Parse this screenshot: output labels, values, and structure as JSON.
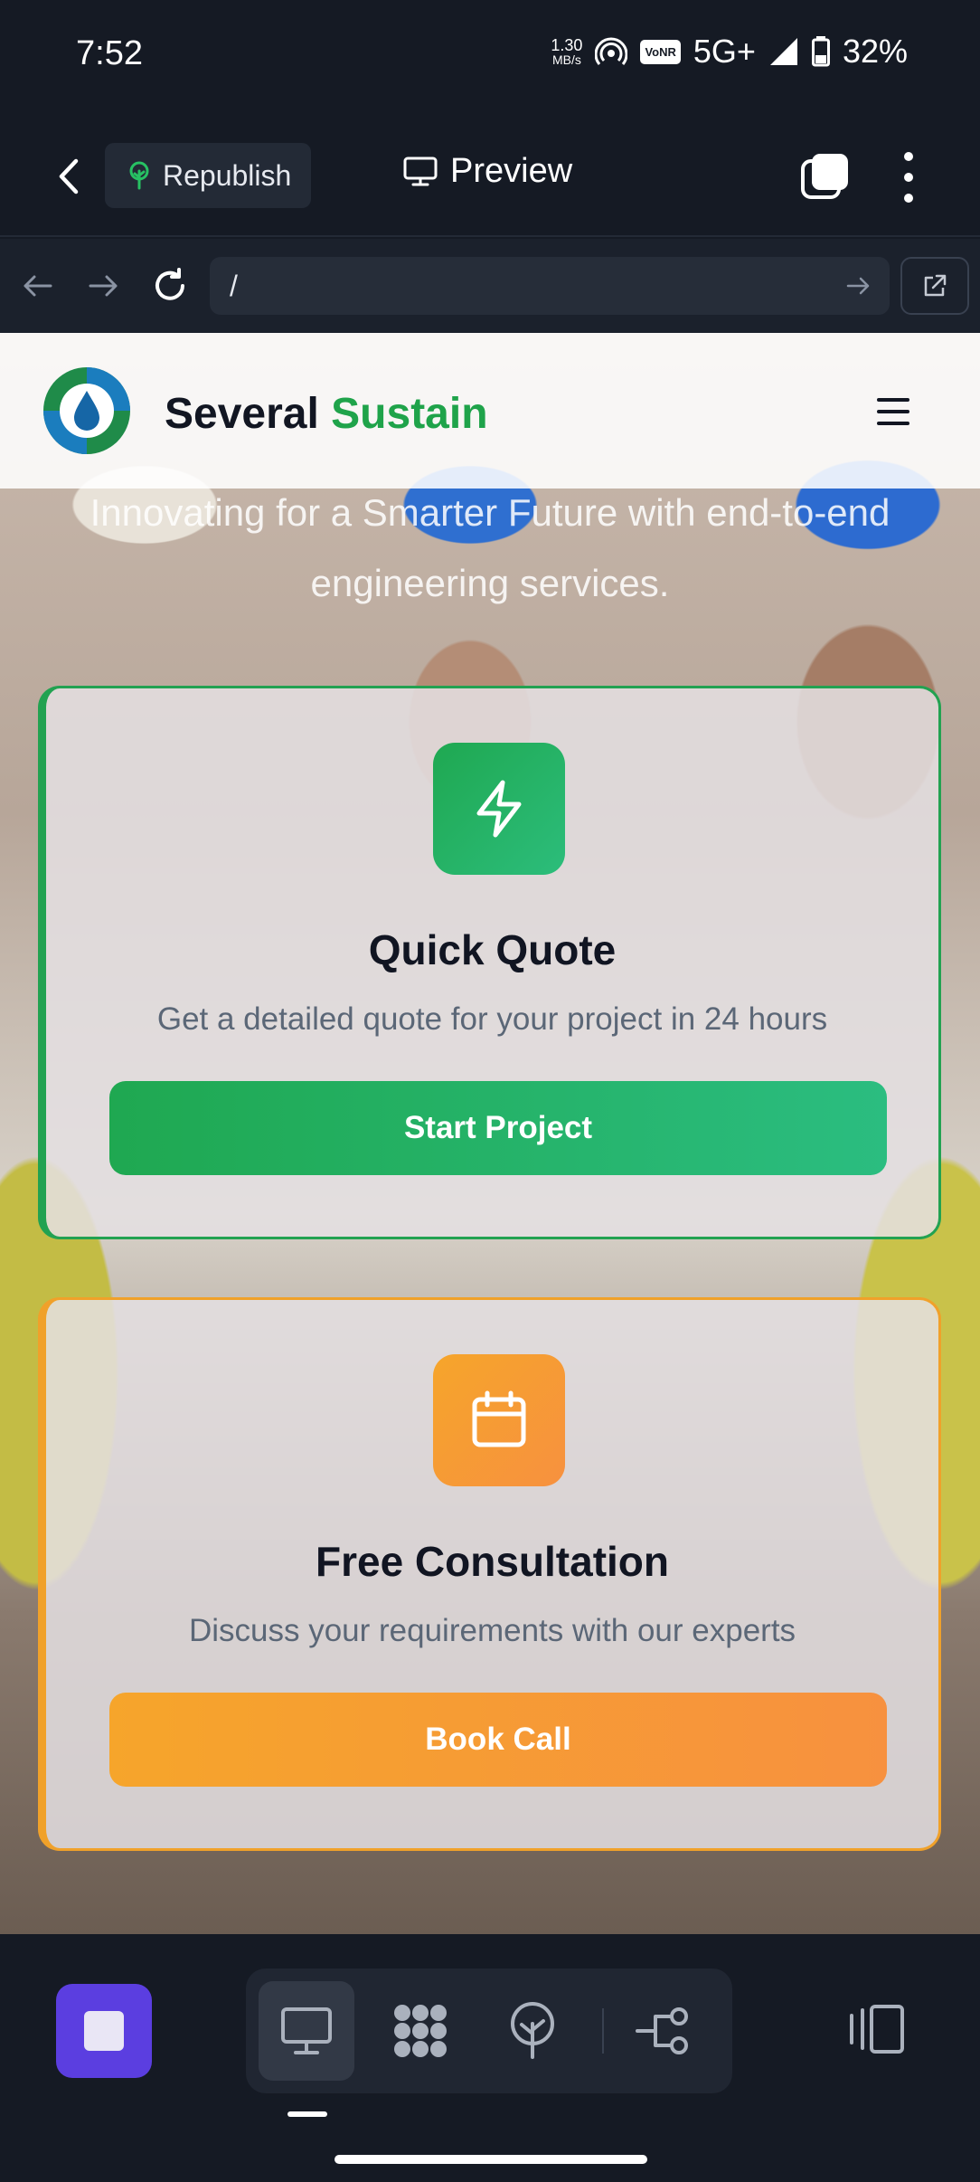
{
  "status_bar": {
    "time": "7:52",
    "net_speed_value": "1.30",
    "net_speed_unit": "MB/s",
    "volte_badge": "VoNR",
    "network": "5G+",
    "battery": "32%"
  },
  "app_bar": {
    "republish_label": "Republish",
    "preview_label": "Preview"
  },
  "url_bar": {
    "url": "/"
  },
  "site": {
    "brand_first": "Several",
    "brand_accent": "Sustain",
    "hero_text": "Innovating for a Smarter Future with end-to-end engineering services."
  },
  "cards": [
    {
      "title": "Quick Quote",
      "description": "Get a detailed quote for your project in 24 hours",
      "button_label": "Start Project",
      "icon": "lightning-icon",
      "accent": "#22a251"
    },
    {
      "title": "Free Consultation",
      "description": "Discuss your requirements with our experts",
      "button_label": "Book Call",
      "icon": "calendar-icon",
      "accent": "#f0a12a"
    }
  ],
  "bottom_bar": {
    "tools": [
      "desktop-icon",
      "apps-grid-icon",
      "deploy-icon",
      "workflow-icon"
    ],
    "active_tool": "desktop-icon"
  }
}
